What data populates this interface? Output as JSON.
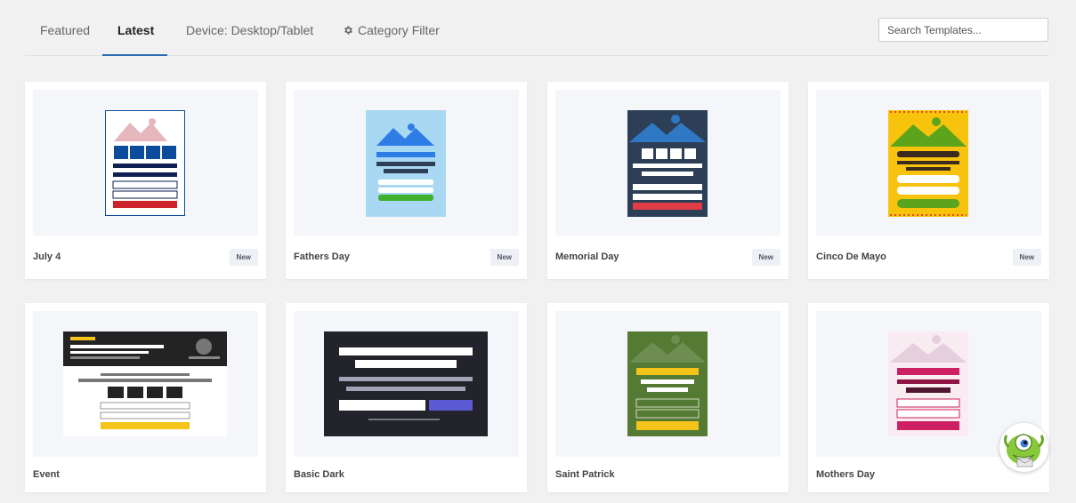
{
  "tabs": [
    {
      "label": "Featured",
      "active": false
    },
    {
      "label": "Latest",
      "active": true
    },
    {
      "label": "Device: Desktop/Tablet",
      "active": false
    },
    {
      "label": "Category Filter",
      "active": false,
      "icon": "gear-icon"
    }
  ],
  "search": {
    "placeholder": "Search Templates..."
  },
  "templates": [
    {
      "name": "July 4",
      "badge": "New"
    },
    {
      "name": "Fathers Day",
      "badge": "New"
    },
    {
      "name": "Memorial Day",
      "badge": "New"
    },
    {
      "name": "Cinco De Mayo",
      "badge": "New"
    },
    {
      "name": "Event",
      "badge": ""
    },
    {
      "name": "Basic Dark",
      "badge": ""
    },
    {
      "name": "Saint Patrick",
      "badge": ""
    },
    {
      "name": "Mothers Day",
      "badge": ""
    }
  ],
  "colors": {
    "tab_active_underline": "#2b6cb0",
    "july4_blue": "#0d4c9a",
    "july4_red": "#cc2229",
    "fathers_bg": "#a9d8f2",
    "fathers_blue": "#2e7de6",
    "fathers_green": "#3db12b",
    "memorial_bg": "#2d3f56",
    "memorial_red": "#e23c46",
    "cinco_yellow": "#f8c30c",
    "cinco_green": "#5ca41c",
    "basic_dark_bg": "#22232b",
    "basic_dark_button": "#5c59d4",
    "patrick_green": "#557a33",
    "patrick_yellow": "#f5c41b",
    "mothers_pink": "#cc2062"
  },
  "widgets": {
    "chat_launcher_icon": "monster-mascot-icon"
  }
}
